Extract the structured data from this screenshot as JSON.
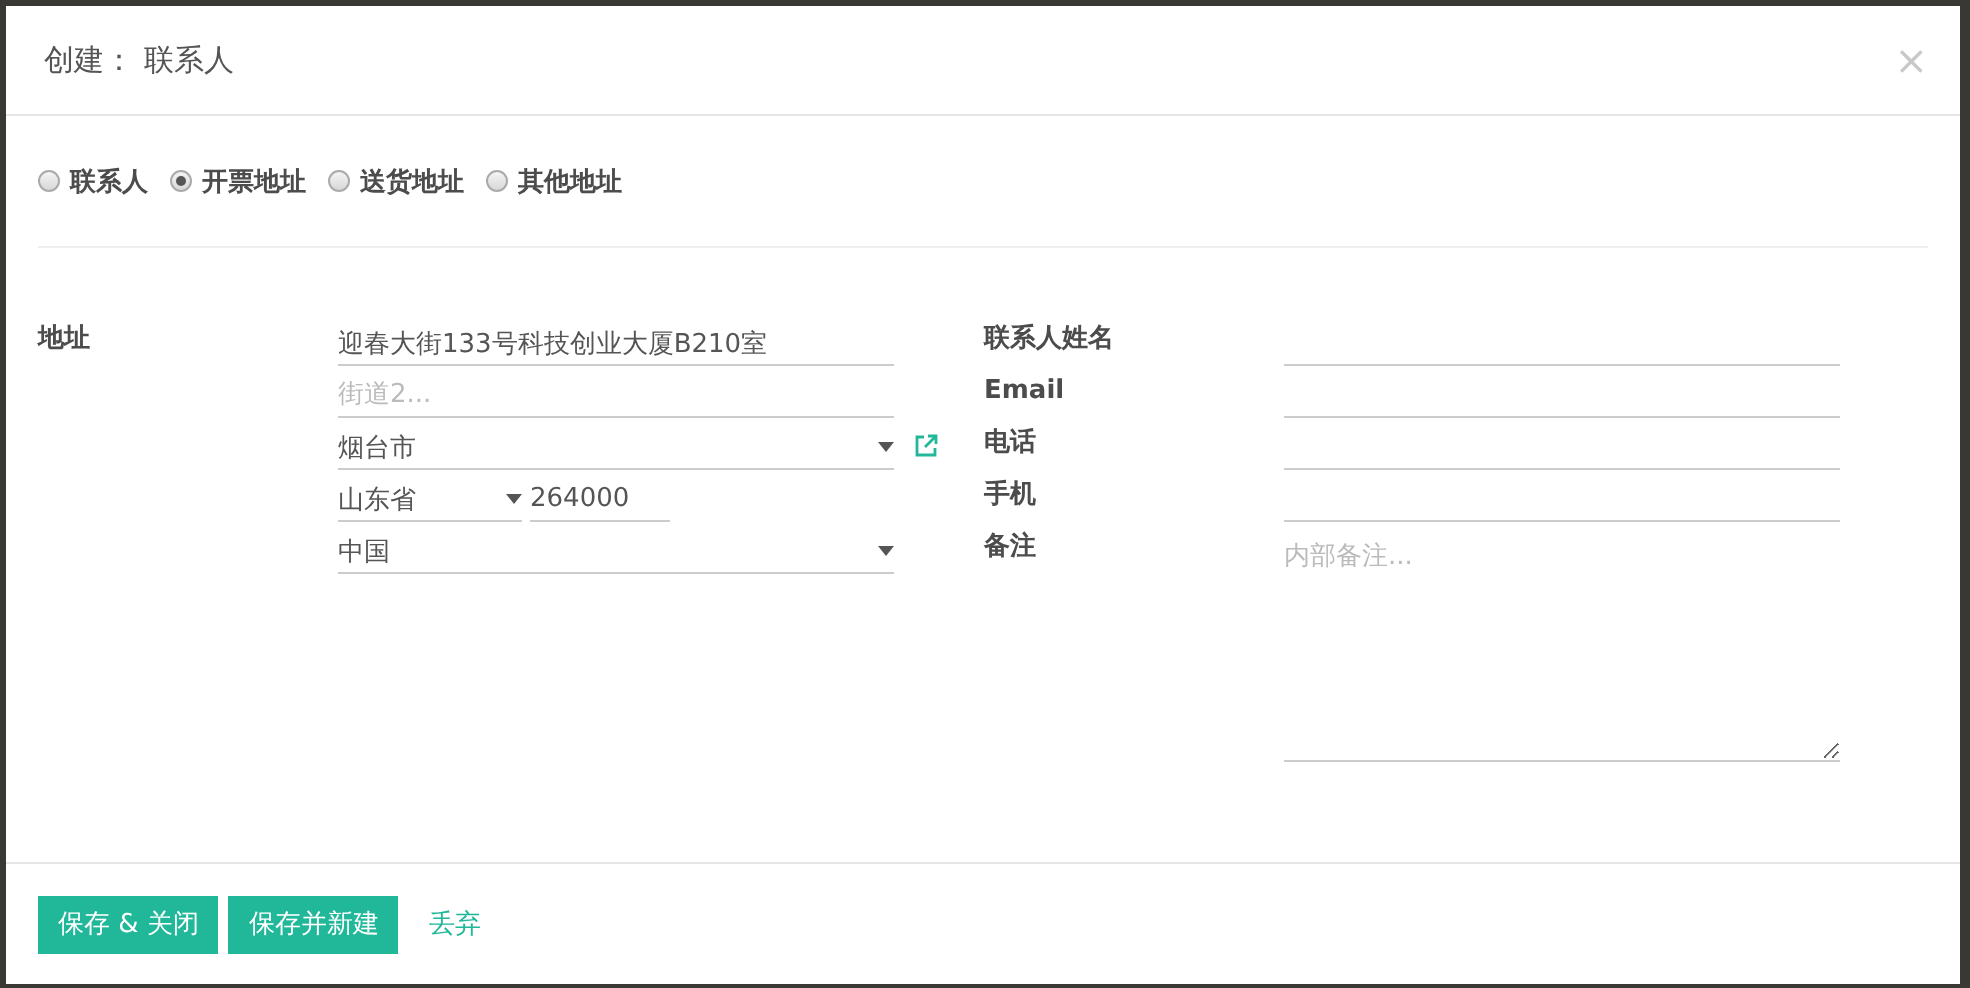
{
  "dialog": {
    "title": "创建： 联系人",
    "close": "×"
  },
  "address_types": [
    {
      "label": "联系人",
      "selected": false
    },
    {
      "label": "开票地址",
      "selected": true
    },
    {
      "label": "送货地址",
      "selected": false
    },
    {
      "label": "其他地址",
      "selected": false
    }
  ],
  "address": {
    "label": "地址",
    "street": {
      "value": "迎春大街133号科技创业大厦B210室"
    },
    "street2": {
      "placeholder": "街道2..."
    },
    "city": {
      "value": "烟台市"
    },
    "state": {
      "value": "山东省"
    },
    "zip": {
      "value": "264000"
    },
    "country": {
      "value": "中国"
    }
  },
  "contact_fields": [
    {
      "label": "联系人姓名",
      "kind": "input"
    },
    {
      "label": "Email",
      "kind": "input"
    },
    {
      "label": "电话",
      "kind": "input"
    },
    {
      "label": "手机",
      "kind": "input"
    },
    {
      "label": "备注",
      "kind": "textarea",
      "placeholder": "内部备注..."
    }
  ],
  "buttons": [
    {
      "label": "保存 & 关闭",
      "kind": "primary"
    },
    {
      "label": "保存并新建",
      "kind": "primary"
    },
    {
      "label": "丢弃",
      "kind": "link"
    }
  ]
}
